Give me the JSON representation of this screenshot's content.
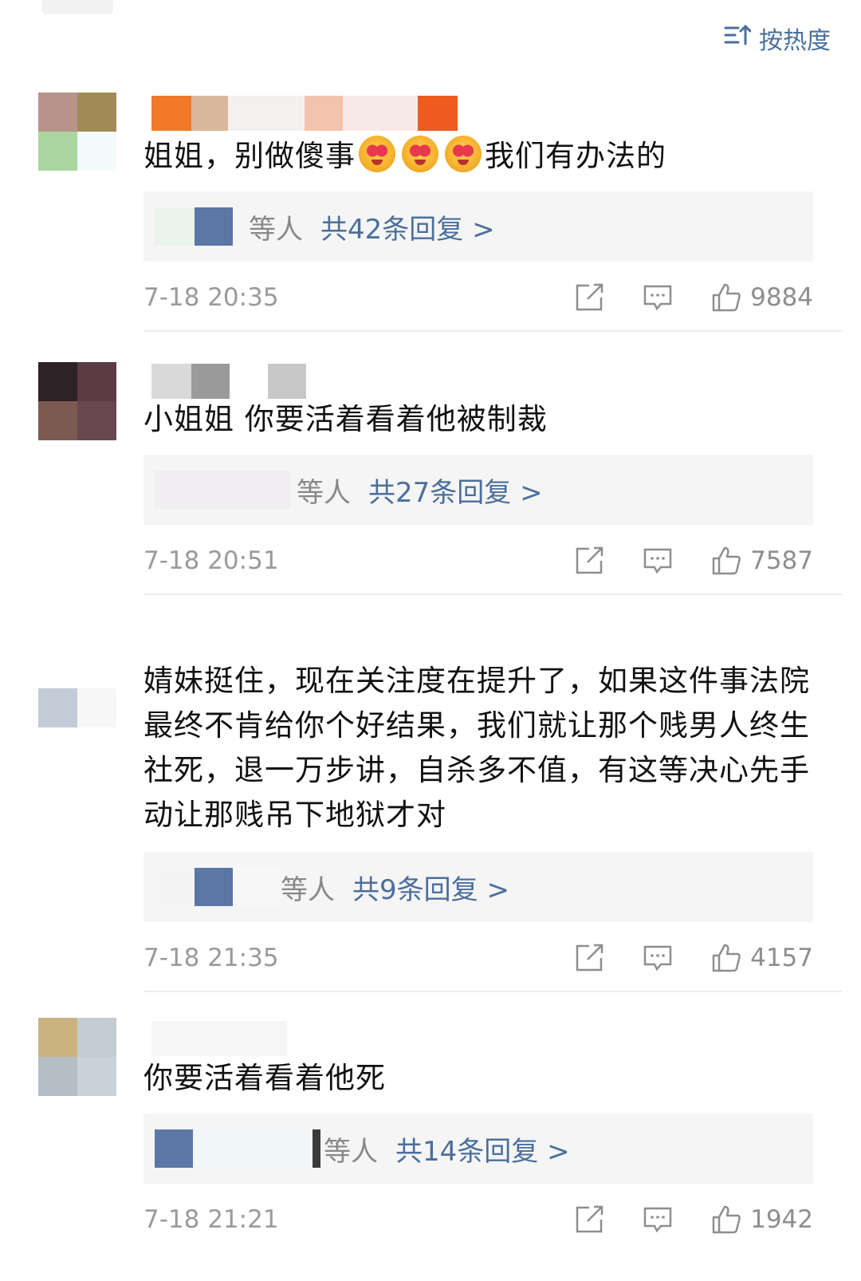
{
  "sort": {
    "label": "按热度",
    "icon": "sort-icon"
  },
  "colors": {
    "link": "#4b6f9c",
    "meta": "#9a9a9a",
    "reply_bg": "#f5f5f5"
  },
  "comments": [
    {
      "text_parts": [
        "姐姐，别做傻事",
        "我们有办法的"
      ],
      "emoji_count": 3,
      "reply_suffix": "等人",
      "reply_count": "共42条回复 >",
      "time": "7-18 20:35",
      "likes": "9884"
    },
    {
      "text": "小姐姐 你要活着看着他被制裁",
      "reply_suffix": "等人",
      "reply_count": "共27条回复 >",
      "time": "7-18 20:51",
      "likes": "7587"
    },
    {
      "text": "婧妹挺住，现在关注度在提升了，如果这件事法院最终不肯给你个好结果，我们就让那个贱男人终生社死，退一万步讲，自杀多不值，有这等决心先手动让那贱吊下地狱才对",
      "reply_suffix": "等人",
      "reply_count": "共9条回复 >",
      "time": "7-18 21:35",
      "likes": "4157"
    },
    {
      "text": "你要活着看着他死",
      "reply_suffix": "等人",
      "reply_count": "共14条回复 >",
      "time": "7-18 21:21",
      "likes": "1942"
    }
  ],
  "icons": {
    "share": "share-icon",
    "comment": "comment-icon",
    "like": "like-icon"
  }
}
